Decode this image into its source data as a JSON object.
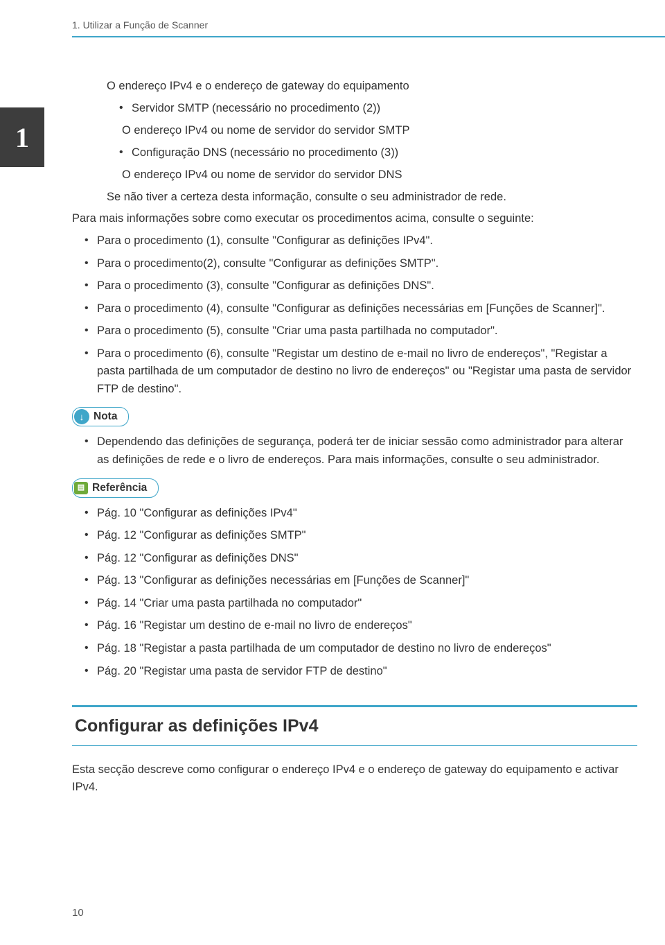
{
  "header": {
    "title": "1. Utilizar a Função de Scanner"
  },
  "chapter_tab": "1",
  "intro_block": {
    "line1": "O endereço IPv4 e o endereço de gateway do equipamento",
    "bullets1": [
      "Servidor SMTP (necessário no procedimento (2))"
    ],
    "line2": "O endereço IPv4 ou nome de servidor do servidor SMTP",
    "bullets2": [
      "Configuração DNS (necessário no procedimento (3))"
    ],
    "line3": "O endereço IPv4 ou nome de servidor do servidor DNS",
    "line4": "Se não tiver a certeza desta informação, consulte o seu administrador de rede."
  },
  "more_info": "Para mais informações sobre como executar os procedimentos acima, consulte o seguinte:",
  "procedures": [
    "Para o procedimento (1), consulte \"Configurar as definições IPv4\".",
    "Para o procedimento(2), consulte \"Configurar as definições SMTP\".",
    "Para o procedimento (3), consulte \"Configurar as definições DNS\".",
    "Para o procedimento (4), consulte \"Configurar as definições necessárias em [Funções de Scanner]\".",
    "Para o procedimento (5), consulte \"Criar uma pasta partilhada no computador\".",
    "Para o procedimento (6), consulte \"Registar um destino de e-mail no livro de endereços\", \"Registar a pasta partilhada de um computador de destino no livro de endereços\" ou \"Registar uma pasta de servidor FTP de destino\"."
  ],
  "nota": {
    "label": "Nota",
    "items": [
      "Dependendo das definições de segurança, poderá ter de iniciar sessão como administrador para alterar as definições de rede e o livro de endereços. Para mais informações, consulte o seu administrador."
    ]
  },
  "referencia": {
    "label": "Referência",
    "items": [
      "Pág. 10 \"Configurar as definições IPv4\"",
      "Pág. 12 \"Configurar as definições SMTP\"",
      "Pág. 12 \"Configurar as definições DNS\"",
      "Pág. 13 \"Configurar as definições necessárias em [Funções de Scanner]\"",
      "Pág. 14 \"Criar uma pasta partilhada no computador\"",
      "Pág. 16 \"Registar um destino de e-mail no livro de endereços\"",
      "Pág. 18 \"Registar a pasta partilhada de um computador de destino no livro de endereços\"",
      "Pág. 20 \"Registar uma pasta de servidor FTP de destino\""
    ]
  },
  "section_heading": "Configurar as definições IPv4",
  "closing": "Esta secção descreve como configurar o endereço IPv4 e o endereço de gateway do equipamento e activar IPv4.",
  "page_number": "10"
}
